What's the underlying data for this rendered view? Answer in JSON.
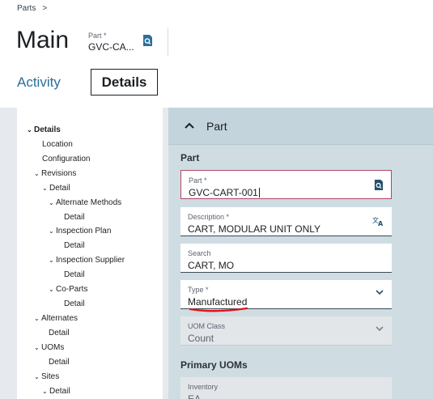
{
  "breadcrumb": {
    "root": "Parts",
    "separator": ">"
  },
  "header": {
    "title": "Main",
    "part_label": "Part *",
    "part_value": "GVC-CA..."
  },
  "tabs": {
    "activity": "Activity",
    "details": "Details"
  },
  "tree": {
    "items": [
      {
        "label": "Details",
        "chevron": "v",
        "bold": true
      },
      {
        "label": "Location",
        "chevron": ""
      },
      {
        "label": "Configuration",
        "chevron": ""
      },
      {
        "label": "Revisions",
        "chevron": "v"
      },
      {
        "label": "Detail",
        "chevron": "v"
      },
      {
        "label": "Alternate Methods",
        "chevron": "v"
      },
      {
        "label": "Detail",
        "chevron": ""
      },
      {
        "label": "Inspection Plan",
        "chevron": "v"
      },
      {
        "label": "Detail",
        "chevron": ""
      },
      {
        "label": "Inspection Supplier",
        "chevron": "v"
      },
      {
        "label": "Detail",
        "chevron": ""
      },
      {
        "label": "Co-Parts",
        "chevron": "v"
      },
      {
        "label": "Detail",
        "chevron": ""
      },
      {
        "label": "Alternates",
        "chevron": "v"
      },
      {
        "label": "Detail",
        "chevron": ""
      },
      {
        "label": "UOMs",
        "chevron": "v"
      },
      {
        "label": "Detail",
        "chevron": ""
      },
      {
        "label": "Sites",
        "chevron": "v"
      },
      {
        "label": "Detail",
        "chevron": "v"
      }
    ]
  },
  "section": {
    "title": "Part",
    "caret": "^"
  },
  "form": {
    "group_part": "Part",
    "part": {
      "label": "Part *",
      "value": "GVC-CART-001"
    },
    "description": {
      "label": "Description *",
      "value": "CART, MODULAR UNIT ONLY"
    },
    "search": {
      "label": "Search",
      "value": "CART, MO"
    },
    "type": {
      "label": "Type *",
      "value": "Manufactured"
    },
    "uom_class": {
      "label": "UOM Class",
      "value": "Count"
    },
    "group_primary_uoms": "Primary UOMs",
    "inventory": {
      "label": "Inventory",
      "value": "EA"
    }
  },
  "colors": {
    "accent": "#2a6f9b",
    "annotation": "#e0141e",
    "active_border": "#b04761"
  }
}
